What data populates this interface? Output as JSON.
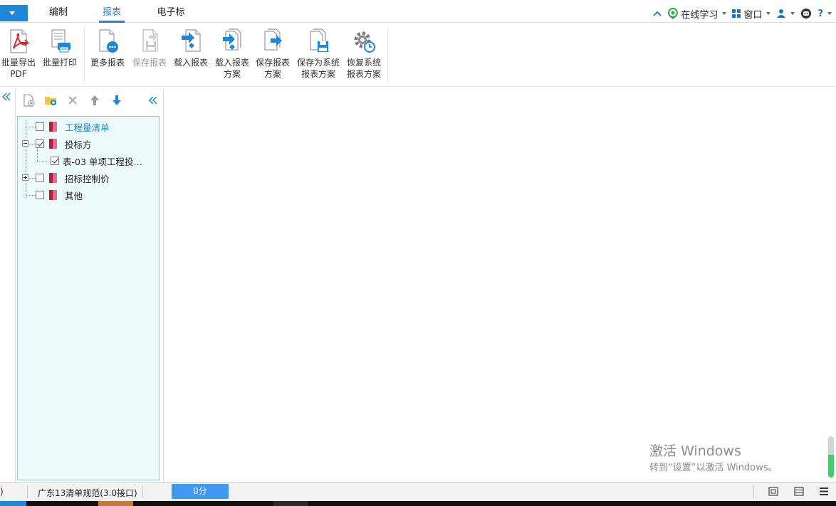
{
  "menubar": {
    "tabs": [
      {
        "label": "编制",
        "active": false
      },
      {
        "label": "报表",
        "active": true
      },
      {
        "label": "电子标",
        "active": false
      }
    ],
    "online_learning": "在线学习",
    "window": "窗口",
    "help": "?"
  },
  "ribbon": {
    "buttons": [
      {
        "label": "批量导出\nPDF",
        "line1": "批量导出",
        "line2": "PDF",
        "icon": "pdf-export-icon",
        "disabled": false
      },
      {
        "label": "批量打印",
        "line1": "批量打印",
        "line2": "",
        "icon": "print-icon",
        "disabled": false
      },
      {
        "label": "更多报表",
        "line1": "更多报表",
        "line2": "",
        "icon": "more-reports-icon",
        "disabled": false
      },
      {
        "label": "保存报表",
        "line1": "保存报表",
        "line2": "",
        "icon": "save-report-icon",
        "disabled": true
      },
      {
        "label": "载入报表",
        "line1": "载入报表",
        "line2": "",
        "icon": "load-report-icon",
        "disabled": false
      },
      {
        "label": "载入报表方案",
        "line1": "载入报表",
        "line2": "方案",
        "icon": "load-scheme-icon",
        "disabled": false
      },
      {
        "label": "保存报表方案",
        "line1": "保存报表",
        "line2": "方案",
        "icon": "save-scheme-icon",
        "disabled": false
      },
      {
        "label": "保存为系统报表方案",
        "line1": "保存为系统",
        "line2": "报表方案",
        "icon": "save-system-scheme-icon",
        "disabled": false
      },
      {
        "label": "恢复系统报表方案",
        "line1": "恢复系统",
        "line2": "报表方案",
        "icon": "restore-system-scheme-icon",
        "disabled": false
      }
    ]
  },
  "tree": {
    "nodes": [
      {
        "label": "工程量清单",
        "checked": false,
        "highlight": true
      },
      {
        "label": "投标方",
        "checked": true,
        "expanded": true
      },
      {
        "label": "表-03 单项工程投…",
        "checked": true
      },
      {
        "label": "招标控制价",
        "checked": false,
        "expanded": false
      },
      {
        "label": "其他",
        "checked": false
      }
    ]
  },
  "watermark": {
    "line1": "激活 Windows",
    "line2": "转到“设置”以激活 Windows。"
  },
  "statusbar": {
    "left_fragment": ")",
    "spec": "广东13清单规范(3.0接口)",
    "score": "0分"
  },
  "colors": {
    "accent": "#1a8ad4",
    "tree_bg": "#edfafb",
    "score_button": "#3f97ee"
  }
}
